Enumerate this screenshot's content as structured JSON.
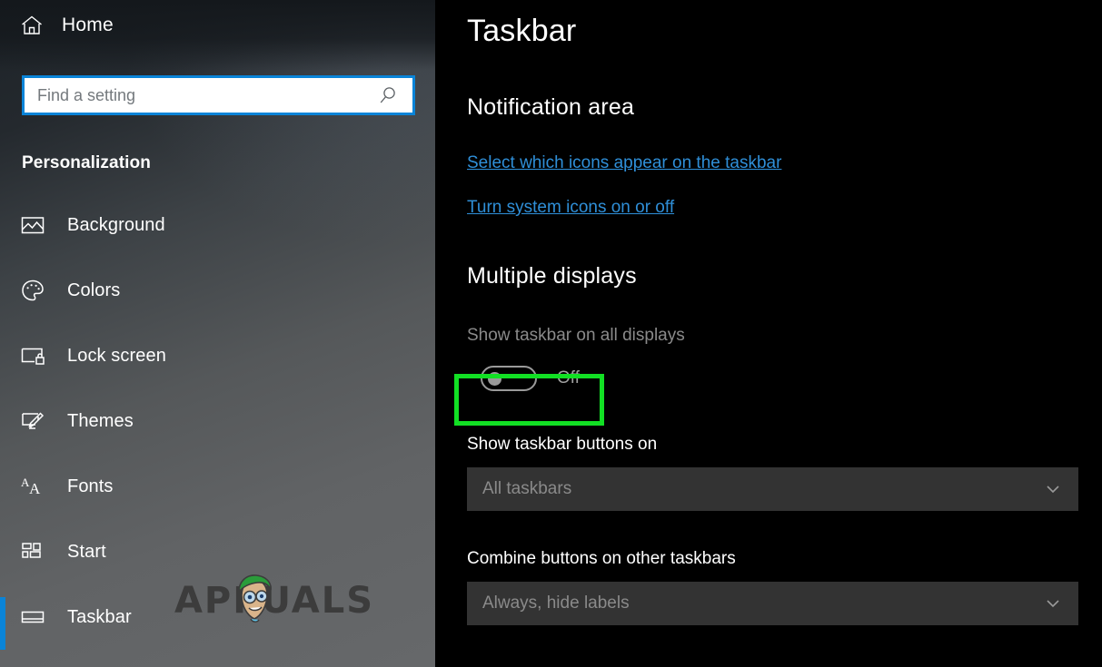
{
  "sidebar": {
    "home": {
      "label": "Home",
      "icon": "home-icon"
    },
    "search": {
      "value": "",
      "placeholder": "Find a setting",
      "icon": "search-icon"
    },
    "category": "Personalization",
    "items": [
      {
        "label": "Background",
        "icon": "picture-icon",
        "selected": false
      },
      {
        "label": "Colors",
        "icon": "palette-icon",
        "selected": false
      },
      {
        "label": "Lock screen",
        "icon": "lock-screen-icon",
        "selected": false
      },
      {
        "label": "Themes",
        "icon": "themes-brush-icon",
        "selected": false
      },
      {
        "label": "Fonts",
        "icon": "fonts-aa-icon",
        "selected": false
      },
      {
        "label": "Start",
        "icon": "start-tiles-icon",
        "selected": false
      },
      {
        "label": "Taskbar",
        "icon": "taskbar-icon",
        "selected": true
      }
    ]
  },
  "watermark": {
    "text": "APPUALS"
  },
  "main": {
    "title": "Taskbar",
    "notification_area": {
      "heading": "Notification area",
      "links": [
        "Select which icons appear on the taskbar",
        "Turn system icons on or off"
      ]
    },
    "multiple_displays": {
      "heading": "Multiple displays",
      "toggle": {
        "label": "Show taskbar on all displays",
        "state": "Off",
        "on": false,
        "highlighted": true
      },
      "fields": [
        {
          "label": "Show taskbar buttons on",
          "value": "All taskbars",
          "icon": "chevron-down-icon",
          "disabled": true
        },
        {
          "label": "Combine buttons on other taskbars",
          "value": "Always, hide labels",
          "icon": "chevron-down-icon",
          "disabled": true
        }
      ]
    }
  },
  "colors": {
    "accent": "#0a84d8",
    "link": "#2f8fd8",
    "highlight": "#12e024",
    "main_bg": "#000000",
    "dropdown_bg": "#333333",
    "disabled_text": "#8a8a8a"
  }
}
